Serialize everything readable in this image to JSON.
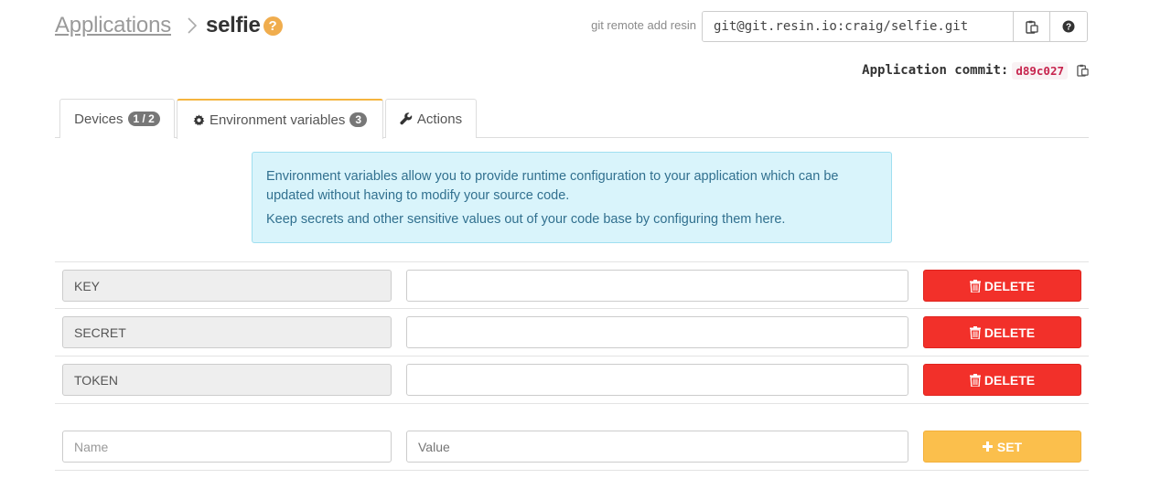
{
  "breadcrumb": {
    "root": "Applications",
    "current": "selfie",
    "help": "?"
  },
  "git": {
    "label": "git remote add resin",
    "url": "git@git.resin.io:craig/selfie.git",
    "copy_icon": "clipboard-icon",
    "help_icon": "question-circle-icon"
  },
  "commit": {
    "label": "Application commit:",
    "hash": "d89c027",
    "copy_icon": "clipboard-icon"
  },
  "tabs": [
    {
      "label": "Devices",
      "count": "1 / 2",
      "icon": ""
    },
    {
      "label": "Environment variables",
      "count": "3",
      "icon": "gear-icon",
      "active": true
    },
    {
      "label": "Actions",
      "count": "",
      "icon": "wrench-icon"
    }
  ],
  "info": {
    "line1": "Environment variables allow you to provide runtime configuration to your application which can be updated without having to modify your source code.",
    "line2": "Keep secrets and other sensitive values out of your code base by configuring them here."
  },
  "variables": [
    {
      "key": "KEY",
      "value": "",
      "action": "DELETE"
    },
    {
      "key": "SECRET",
      "value": "",
      "action": "DELETE"
    },
    {
      "key": "TOKEN",
      "value": "",
      "action": "DELETE"
    }
  ],
  "new_variable": {
    "name_placeholder": "Name",
    "value_placeholder": "Value",
    "action": "SET"
  },
  "colors": {
    "accent": "#f5b53f",
    "danger": "#f2302a",
    "warning": "#fbbf4c",
    "info_bg": "#d9f4fb"
  }
}
